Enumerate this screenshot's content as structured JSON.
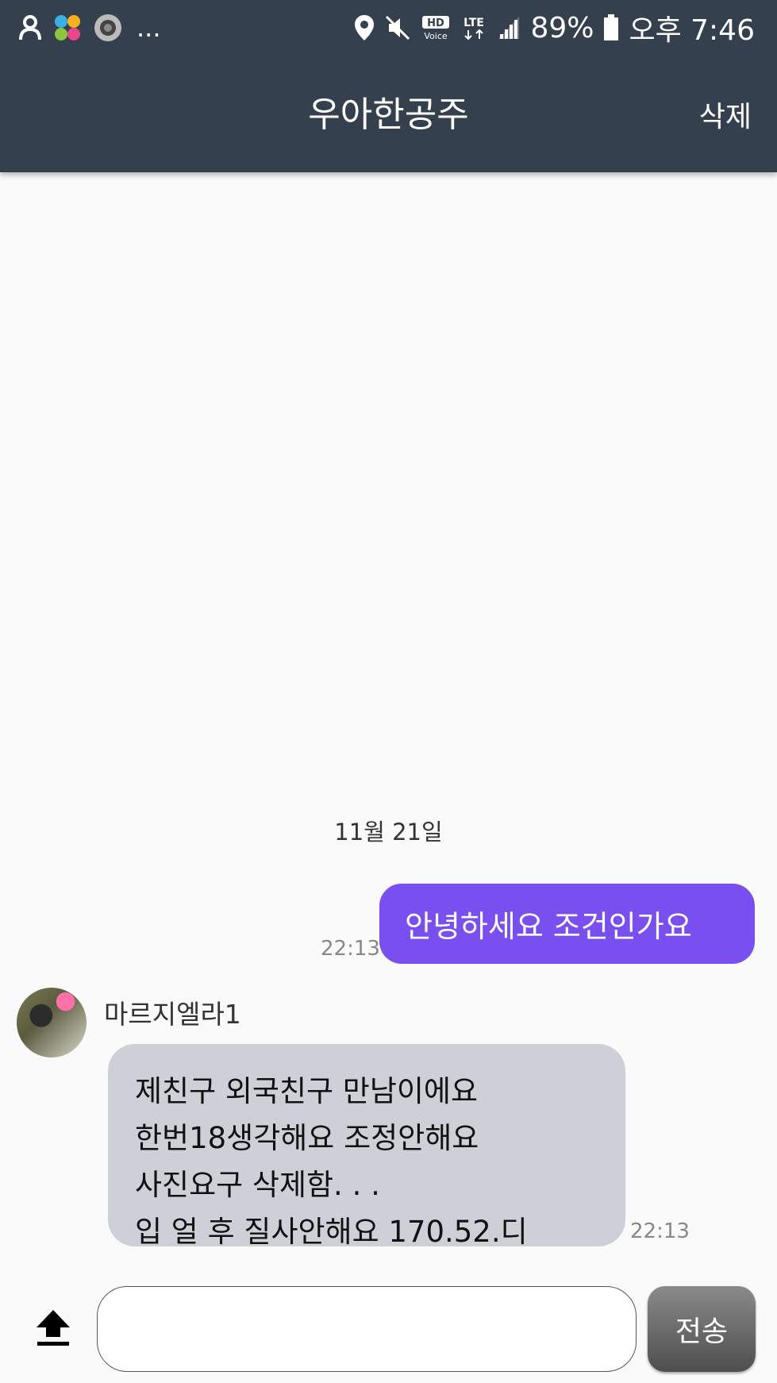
{
  "status_bar": {
    "battery_percent": "89%",
    "time": "오후 7:46",
    "more_indicator": "...",
    "hd_label": "HD",
    "voice_label": "Voice",
    "network_label": "LTE"
  },
  "app_bar": {
    "title": "우아한공주",
    "delete_label": "삭제"
  },
  "chat": {
    "date": "11월 21일",
    "sent": {
      "text": "안녕하세요 조건인가요",
      "time": "22:13",
      "color": "#7a4ff0"
    },
    "received": {
      "sender": "마르지엘라1",
      "lines": [
        "제친구 외국친구 만남이에요",
        "한번18생각해요 조정안해요",
        "사진요구 삭제함. . .",
        "입 얼 후 질사안해요 170.52.디"
      ],
      "time": "22:13",
      "color": "#cdd0d6"
    }
  },
  "composer": {
    "input_value": "",
    "send_label": "전송",
    "upload_icon": "upload-icon"
  },
  "colors": {
    "header": "#35404f",
    "background": "#fafafa"
  }
}
